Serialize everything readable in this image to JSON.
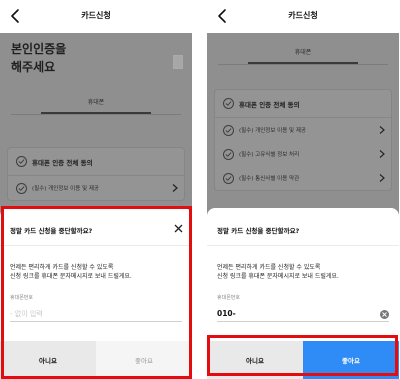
{
  "left": {
    "header_title": "카드신청",
    "title_line1": "본인인증을",
    "title_line2": "해주세요",
    "tab_label": "휴대폰",
    "consent_all": "휴대폰 인증 전체 동의",
    "consent_items": [
      "(필수) 개인정보 이용 및 제공"
    ],
    "sheet": {
      "title": "정말 카드 신청을 중단할까요?",
      "desc_line1": "언제든 편리하게 카드를 신청할 수 있도록",
      "desc_line2": "신청 링크를 휴대폰 문자메시지로 보내 드릴게요.",
      "field_label": "휴대폰번호",
      "placeholder": "- 없이 입력",
      "no_label": "아니요",
      "yes_label": "좋아요"
    }
  },
  "right": {
    "header_title": "카드신청",
    "tab_label": "휴대폰",
    "consent_all": "휴대폰 인증 전체 동의",
    "consent_items": [
      "(필수) 개인정보 이용 및 제공",
      "(필수) 고유식별 정보 처리",
      "(필수) 통신사별 이용 약관"
    ],
    "sheet": {
      "title": "정말 카드 신청을 중단할까요?",
      "desc_line1": "언제든 편리하게 카드를 신청할 수 있도록",
      "desc_line2": "신청 링크를 휴대폰 문자메시지로 보내 드릴게요.",
      "field_label": "휴대폰번호",
      "value": "010-",
      "no_label": "아니요",
      "yes_label": "좋아요"
    }
  },
  "colors": {
    "highlight_box": "#e30d10",
    "primary_button": "#2f8bf5",
    "dim_overlay": "#8f8f8f"
  },
  "icons": [
    "back-arrow-icon",
    "check-circle-icon",
    "chevron-right-icon",
    "close-icon",
    "clear-input-icon"
  ]
}
